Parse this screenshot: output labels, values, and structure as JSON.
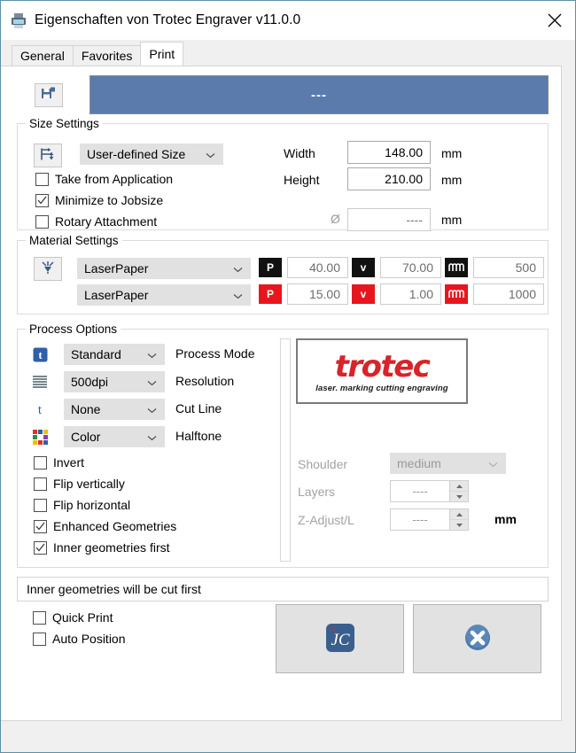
{
  "window": {
    "title": "Eigenschaften von Trotec Engraver v11.0.0",
    "icon": "printer-icon",
    "close_label": "close-icon"
  },
  "tabs": [
    {
      "label": "General",
      "active": false
    },
    {
      "label": "Favorites",
      "active": false
    },
    {
      "label": "Print",
      "active": true
    }
  ],
  "toolbar": {
    "save_icon": "save-as-new-icon",
    "banner_text": "---",
    "banner_color": "#5b7bad"
  },
  "size_settings": {
    "legend": "Size Settings",
    "icon": "resize-icon",
    "preset": "User-defined Size",
    "checkboxes": [
      {
        "label": "Take from Application",
        "checked": false
      },
      {
        "label": "Minimize to Jobsize",
        "checked": true
      },
      {
        "label": "Rotary Attachment",
        "checked": false
      }
    ],
    "width_label": "Width",
    "width_value": "148.00",
    "width_unit": "mm",
    "height_label": "Height",
    "height_value": "210.00",
    "height_unit": "mm",
    "diameter_symbol": "Ø",
    "diameter_value": "----",
    "diameter_unit": "mm"
  },
  "material_settings": {
    "legend": "Material Settings",
    "icon": "laser-material-icon",
    "rows": [
      {
        "material": "LaserPaper",
        "badge_color": "#111111",
        "power_icon": "power-P-icon",
        "power": "40.00",
        "velocity_icon": "velocity-v-icon",
        "velocity": "70.00",
        "frequency_icon": "frequency-wave-icon",
        "frequency": "500"
      },
      {
        "material": "LaserPaper",
        "badge_color": "#e8161c",
        "power_icon": "power-P-icon",
        "power": "15.00",
        "velocity_icon": "velocity-v-icon",
        "velocity": "1.00",
        "frequency_icon": "frequency-wave-icon",
        "frequency": "1000"
      }
    ]
  },
  "process_options": {
    "legend": "Process Options",
    "rows": [
      {
        "icon": "process-mode-icon",
        "value": "Standard",
        "label": "Process Mode"
      },
      {
        "icon": "resolution-lines-icon",
        "value": "500dpi",
        "label": "Resolution"
      },
      {
        "icon": "cut-line-t-icon",
        "value": "None",
        "label": "Cut Line"
      },
      {
        "icon": "halftone-color-grid-icon",
        "value": "Color",
        "label": "Halftone"
      }
    ],
    "checkboxes": [
      {
        "label": "Invert",
        "checked": false
      },
      {
        "label": "Flip vertically",
        "checked": false
      },
      {
        "label": "Flip horizontal",
        "checked": false
      },
      {
        "label": "Enhanced Geometries",
        "checked": true
      },
      {
        "label": "Inner geometries first",
        "checked": true
      }
    ],
    "logo": {
      "word": "trotec",
      "tagline": "laser. marking cutting engraving",
      "color": "#d8232a"
    },
    "shoulder_label": "Shoulder",
    "shoulder_value": "medium",
    "layers_label": "Layers",
    "layers_value": "----",
    "zadjust_label": "Z-Adjust/L",
    "zadjust_value": "----",
    "zadjust_unit": "mm"
  },
  "status": {
    "message": "Inner geometries will be cut first"
  },
  "bottom": {
    "checkboxes": [
      {
        "label": "Quick Print",
        "checked": false
      },
      {
        "label": "Auto Position",
        "checked": false
      }
    ],
    "buttons": [
      {
        "name": "jobcontrol-button",
        "icon": "jobcontrol-jc-icon"
      },
      {
        "name": "cancel-button",
        "icon": "cancel-x-circle-icon"
      }
    ]
  }
}
